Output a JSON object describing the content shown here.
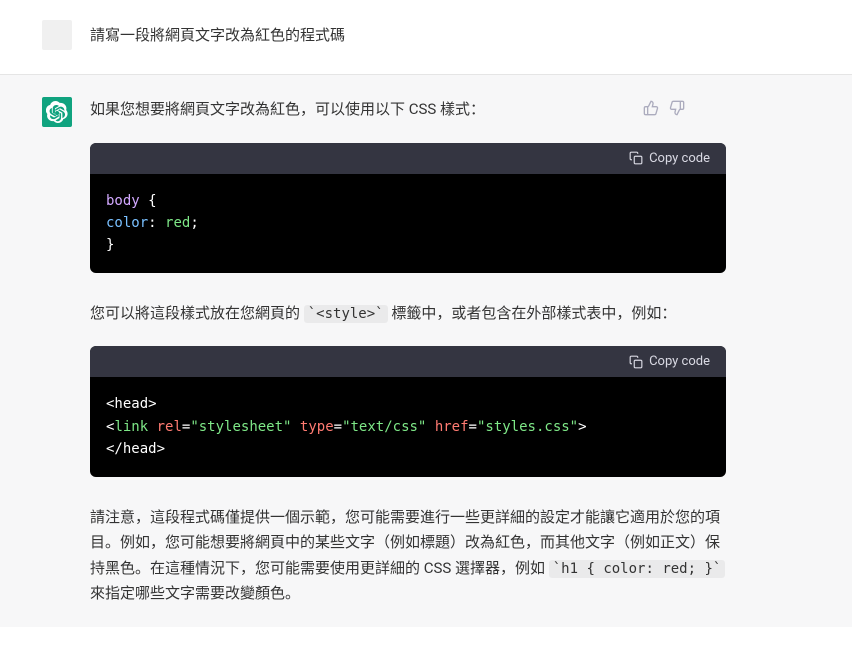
{
  "user": {
    "message": "請寫一段將網頁文字改為紅色的程式碼"
  },
  "assistant": {
    "intro": "如果您想要將網頁文字改為紅色，可以使用以下 CSS 樣式：",
    "copy_label": "Copy code",
    "code1_line1_sel": "body",
    "code1_line1_brace": " {",
    "code1_line2_indent": "  ",
    "code1_line2_prop": "color",
    "code1_line2_colon": ": ",
    "code1_line2_val": "red",
    "code1_line2_semi": ";",
    "code1_line3": "}",
    "middle_pre": "您可以將這段樣式放在您網頁的 ",
    "middle_code": "`<style>`",
    "middle_post": " 標籤中，或者包含在外部樣式表中，例如：",
    "code2_line1": "<head>",
    "code2_line2_indent": "  ",
    "code2_line2_open": "<",
    "code2_line2_tag": "link",
    "code2_line2_sp1": " ",
    "code2_line2_a1": "rel",
    "code2_line2_eq1": "=",
    "code2_line2_v1": "\"stylesheet\"",
    "code2_line2_sp2": " ",
    "code2_line2_a2": "type",
    "code2_line2_eq2": "=",
    "code2_line2_v2": "\"text/css\"",
    "code2_line2_sp3": " ",
    "code2_line2_a3": "href",
    "code2_line2_eq3": "=",
    "code2_line2_v3": "\"styles.css\"",
    "code2_line2_close": ">",
    "code2_line3": "</head>",
    "outro_pre": "請注意，這段程式碼僅提供一個示範，您可能需要進行一些更詳細的設定才能讓它適用於您的項目。例如，您可能想要將網頁中的某些文字（例如標題）改為紅色，而其他文字（例如正文）保持黑色。在這種情況下，您可能需要使用更詳細的 CSS 選擇器，例如 ",
    "outro_code": "`h1 { color: red; }`",
    "outro_post": " 來指定哪些文字需要改變顏色。"
  }
}
